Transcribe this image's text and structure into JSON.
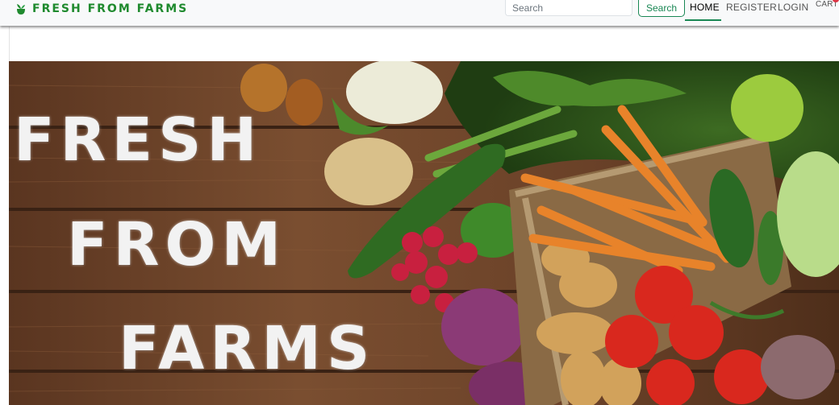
{
  "navbar": {
    "brand": "FRESH FROM FARMS",
    "brand_icon": "leaf-pot-icon",
    "search_placeholder": "Search",
    "search_button": "Search",
    "links": {
      "home": "HOME",
      "register": "REGISTER",
      "login": "LOGIN",
      "cart": "CART"
    },
    "colors": {
      "brand": "#1f8a2e",
      "accent": "#198754",
      "badge": "#dc3545",
      "bar_bg": "#f8f9fa"
    }
  },
  "hero": {
    "title_lines": [
      "FRESH",
      "FROM",
      "FARMS"
    ],
    "image": "fresh-vegetables-on-wooden-table",
    "colors": {
      "wood": "#6b4228",
      "title": "#f2f2f2"
    }
  }
}
